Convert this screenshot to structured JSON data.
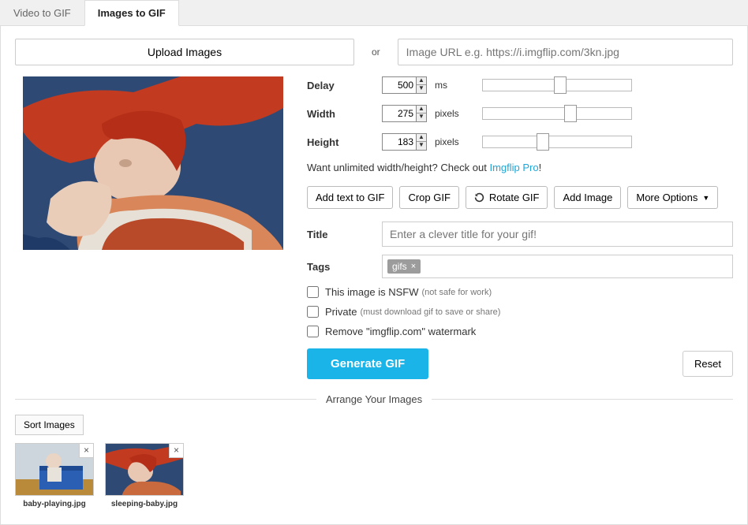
{
  "tabs": {
    "video": "Video to GIF",
    "images": "Images to GIF"
  },
  "upload_label": "Upload Images",
  "or": "or",
  "url_placeholder": "Image URL e.g. https://i.imgflip.com/3kn.jpg",
  "params": {
    "delay": {
      "label": "Delay",
      "value": "500",
      "unit": "ms",
      "thumb_pct": 48
    },
    "width": {
      "label": "Width",
      "value": "275",
      "unit": "pixels",
      "thumb_pct": 55
    },
    "height": {
      "label": "Height",
      "value": "183",
      "unit": "pixels",
      "thumb_pct": 36
    }
  },
  "promo": {
    "text": "Want unlimited width/height? Check out ",
    "link": "Imgflip Pro",
    "after": "!"
  },
  "buttons": {
    "add_text": "Add text to GIF",
    "crop": "Crop GIF",
    "rotate": "Rotate GIF",
    "add_image": "Add Image",
    "more": "More Options"
  },
  "fields": {
    "title_label": "Title",
    "title_placeholder": "Enter a clever title for your gif!",
    "tags_label": "Tags",
    "tag_chip": "gifs"
  },
  "checks": {
    "nsfw": {
      "label": "This image is NSFW",
      "sub": "(not safe for work)"
    },
    "private": {
      "label": "Private",
      "sub": "(must download gif to save or share)"
    },
    "watermark": {
      "label": "Remove \"imgflip.com\" watermark"
    }
  },
  "generate": "Generate GIF",
  "reset": "Reset",
  "arrange": "Arrange Your Images",
  "sort": "Sort Images",
  "thumbs": [
    {
      "name": "baby-playing.jpg"
    },
    {
      "name": "sleeping-baby.jpg"
    }
  ]
}
